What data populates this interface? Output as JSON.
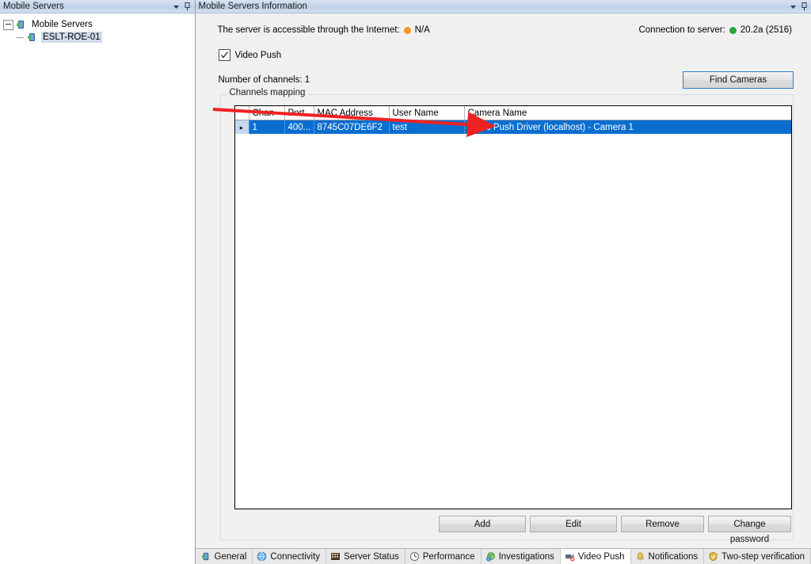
{
  "left_panel": {
    "caption": "Mobile Servers",
    "caption_icons": [
      "chevron-down-icon",
      "pin-icon"
    ],
    "tree": {
      "root": {
        "label": "Mobile Servers",
        "icon": "mobile-server-icon",
        "expanded": true
      },
      "children": [
        {
          "label": "ESLT-ROE-01",
          "icon": "mobile-server-icon",
          "selected": true
        }
      ]
    }
  },
  "right_panel": {
    "caption": "Mobile Servers Information",
    "caption_icons": [
      "chevron-down-icon",
      "pin-icon"
    ],
    "status": {
      "internet_label": "The server is accessible through the Internet:",
      "internet_value": "N/A",
      "internet_dot_color": "#f79520",
      "connection_label": "Connection to server:",
      "connection_value": "20.2a (2516)",
      "connection_dot_color": "#25a63b"
    },
    "video_push": {
      "label": "Video Push",
      "checked": true
    },
    "channels": {
      "count_label": "Number of channels: 1",
      "find_cameras_label": "Find Cameras"
    },
    "groupbox": {
      "legend": "Channels mapping"
    },
    "grid": {
      "columns": [
        {
          "key": "indicator",
          "label": ""
        },
        {
          "key": "channel",
          "label": "Chan"
        },
        {
          "key": "port",
          "label": "Port"
        },
        {
          "key": "mac",
          "label": "MAC Address"
        },
        {
          "key": "user",
          "label": "User Name"
        },
        {
          "key": "camera",
          "label": "Camera Name"
        }
      ],
      "rows": [
        {
          "indicator": "▸",
          "channel": "1",
          "port": "400...",
          "mac": "8745C07DE6F2",
          "user": "test",
          "camera": "Video Push Driver (localhost) - Camera 1",
          "selected": true
        }
      ]
    },
    "buttons": {
      "add": "Add",
      "edit": "Edit",
      "remove": "Remove",
      "change_password": "Change password"
    }
  },
  "tabs": [
    {
      "label": "General",
      "icon": "mobile-server-icon",
      "active": false
    },
    {
      "label": "Connectivity",
      "icon": "globe-icon",
      "active": false
    },
    {
      "label": "Server Status",
      "icon": "server-status-icon",
      "active": false
    },
    {
      "label": "Performance",
      "icon": "gauge-icon",
      "active": false
    },
    {
      "label": "Investigations",
      "icon": "investigations-icon",
      "active": false
    },
    {
      "label": "Video Push",
      "icon": "video-push-icon",
      "active": true
    },
    {
      "label": "Notifications",
      "icon": "bell-icon",
      "active": false
    },
    {
      "label": "Two-step verification",
      "icon": "shield-icon",
      "active": false
    }
  ],
  "annotation": {
    "type": "arrow",
    "color": "#ef2222"
  }
}
